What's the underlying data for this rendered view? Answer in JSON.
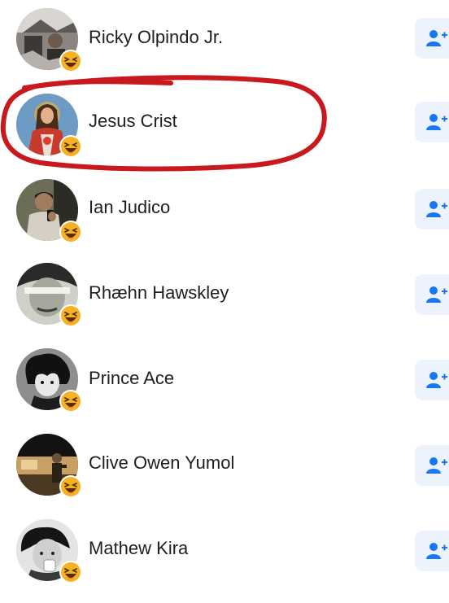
{
  "people": [
    {
      "name": "Ricky Olpindo Jr.",
      "avatar_icon": "profile-photo",
      "reaction_icon": "haha-reaction-icon",
      "action_icon": "add-friend-icon"
    },
    {
      "name": "Jesus Crist",
      "avatar_icon": "profile-photo",
      "reaction_icon": "haha-reaction-icon",
      "action_icon": "add-friend-icon"
    },
    {
      "name": "Ian Judico",
      "avatar_icon": "profile-photo",
      "reaction_icon": "haha-reaction-icon",
      "action_icon": "add-friend-icon"
    },
    {
      "name": "Rhæhn Hawskley",
      "avatar_icon": "profile-photo",
      "reaction_icon": "haha-reaction-icon",
      "action_icon": "add-friend-icon"
    },
    {
      "name": "Prince Ace",
      "avatar_icon": "profile-photo",
      "reaction_icon": "haha-reaction-icon",
      "action_icon": "add-friend-icon"
    },
    {
      "name": "Clive Owen Yumol",
      "avatar_icon": "profile-photo",
      "reaction_icon": "haha-reaction-icon",
      "action_icon": "add-friend-icon"
    },
    {
      "name": "Mathew Kira",
      "avatar_icon": "profile-photo",
      "reaction_icon": "haha-reaction-icon",
      "action_icon": "add-friend-icon"
    }
  ],
  "colors": {
    "name_text": "#1c1e21",
    "add_button_bg": "#edf3fc",
    "add_icon": "#1877f2",
    "highlight_ring": "#c8191e",
    "haha_face": "#f7b125"
  }
}
